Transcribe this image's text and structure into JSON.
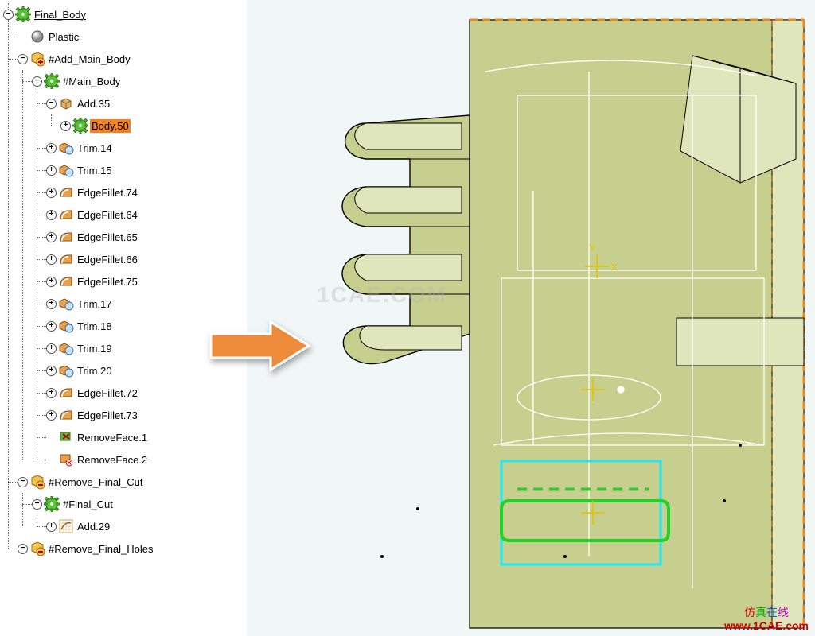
{
  "tree": {
    "root": {
      "label": "Final_Body",
      "icon": "gear-green",
      "underline": true,
      "expand": "-",
      "interact": true,
      "children": [
        {
          "label": "Plastic",
          "icon": "sphere-grey",
          "expand": "",
          "interact": true
        },
        {
          "label": "#Add_Main_Body",
          "icon": "bool-add",
          "expand": "-",
          "interact": true,
          "children": [
            {
              "label": "#Main_Body",
              "icon": "gear-green",
              "expand": "-",
              "interact": true,
              "children": [
                {
                  "label": "Add.35",
                  "icon": "body-tan",
                  "expand": "-",
                  "interact": true,
                  "children": [
                    {
                      "label": "Body.50",
                      "icon": "gear-green",
                      "expand": "+",
                      "selected": true,
                      "interact": true
                    }
                  ]
                },
                {
                  "label": "Trim.14",
                  "icon": "trim",
                  "expand": "+",
                  "interact": true
                },
                {
                  "label": "Trim.15",
                  "icon": "trim",
                  "expand": "+",
                  "interact": true
                },
                {
                  "label": "EdgeFillet.74",
                  "icon": "fillet",
                  "expand": "+",
                  "interact": true
                },
                {
                  "label": "EdgeFillet.64",
                  "icon": "fillet",
                  "expand": "+",
                  "interact": true
                },
                {
                  "label": "EdgeFillet.65",
                  "icon": "fillet",
                  "expand": "+",
                  "interact": true
                },
                {
                  "label": "EdgeFillet.66",
                  "icon": "fillet",
                  "expand": "+",
                  "interact": true
                },
                {
                  "label": "EdgeFillet.75",
                  "icon": "fillet",
                  "expand": "+",
                  "interact": true
                },
                {
                  "label": "Trim.17",
                  "icon": "trim",
                  "expand": "+",
                  "interact": true
                },
                {
                  "label": "Trim.18",
                  "icon": "trim",
                  "expand": "+",
                  "interact": true
                },
                {
                  "label": "Trim.19",
                  "icon": "trim",
                  "expand": "+",
                  "interact": true
                },
                {
                  "label": "Trim.20",
                  "icon": "trim",
                  "expand": "+",
                  "interact": true
                },
                {
                  "label": "EdgeFillet.72",
                  "icon": "fillet",
                  "expand": "+",
                  "interact": true
                },
                {
                  "label": "EdgeFillet.73",
                  "icon": "fillet",
                  "expand": "+",
                  "interact": true
                },
                {
                  "label": "RemoveFace.1",
                  "icon": "removeface",
                  "expand": "",
                  "interact": true
                },
                {
                  "label": "RemoveFace.2",
                  "icon": "removeface2",
                  "expand": "",
                  "interact": true
                }
              ]
            }
          ]
        },
        {
          "label": "#Remove_Final_Cut",
          "icon": "bool-remove",
          "expand": "-",
          "interact": true,
          "children": [
            {
              "label": "#Final_Cut",
              "icon": "gear-green",
              "expand": "-",
              "interact": true,
              "children": [
                {
                  "label": "Add.29",
                  "icon": "sketch",
                  "expand": "+",
                  "interact": true
                }
              ]
            }
          ]
        },
        {
          "label": "#Remove_Final_Holes",
          "icon": "bool-remove",
          "expand": "-",
          "interact": true
        }
      ]
    }
  },
  "colors": {
    "selection_bg": "#f58220",
    "arrow_fill": "#ed8b3a",
    "arrow_stroke": "#ffffff",
    "model_face": "#c7cf8f",
    "model_face_light": "#e0e6bb",
    "model_edge": "#000000",
    "dashed_border": "#e88a1f",
    "wire_white": "#ffffff",
    "highlight_cyan": "#22e6f2",
    "highlight_green": "#25d02a"
  },
  "viewport": {
    "axes": {
      "x_label": "X",
      "y_label": "Y"
    }
  },
  "watermark": {
    "center": "1CAE.COM",
    "cn": "仿真在线",
    "url": "www.1CAE.com"
  }
}
